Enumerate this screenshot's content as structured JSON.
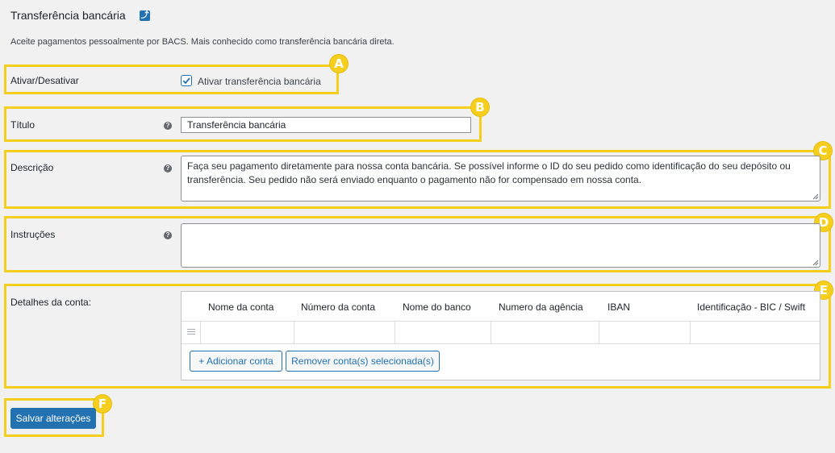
{
  "header": {
    "title": "Transferência bancária",
    "link_icon": "return-link-icon",
    "description": "Aceite pagamentos pessoalmente por BACS. Mais conhecido como transferência bancária direta."
  },
  "badges": [
    "A",
    "B",
    "C",
    "D",
    "E",
    "F"
  ],
  "enable": {
    "label": "Ativar/Desativar",
    "checkbox_label": "Ativar transferência bancária",
    "checked": true
  },
  "title_field": {
    "label": "Título",
    "value": "Transferência bancária"
  },
  "description_field": {
    "label": "Descrição",
    "value": "Faça seu pagamento diretamente para nossa conta bancária. Se possível informe o ID do seu pedido como identificação do seu depósito ou transferência. Seu pedido não será enviado enquanto o pagamento não for compensado em nossa conta."
  },
  "instructions_field": {
    "label": "Instruções",
    "value": ""
  },
  "account_details": {
    "label": "Detalhes da conta:",
    "columns": [
      "Nome da conta",
      "Número da conta",
      "Nome do banco",
      "Numero da agência",
      "IBAN",
      "Identificação - BIC / Swift"
    ],
    "add_button": "+ Adicionar conta",
    "remove_button": "Remover conta(s) selecionada(s)"
  },
  "save_button": "Salvar alterações",
  "colors": {
    "highlight": "#f6cf1e",
    "accent": "#2271b1",
    "background": "#f1f1f1"
  }
}
